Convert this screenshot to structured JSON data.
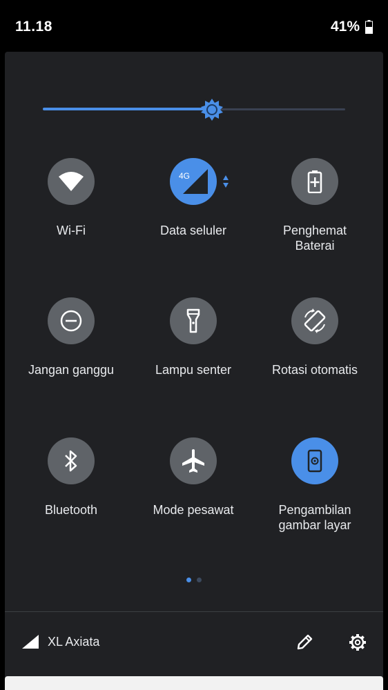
{
  "status_bar": {
    "time": "11.18",
    "battery_text": "41%"
  },
  "brightness": {
    "level": 0.56
  },
  "tiles": [
    {
      "label": "Wi-Fi",
      "icon": "wifi-icon",
      "active": false
    },
    {
      "label": "Data seluler",
      "icon": "cellular-data-icon",
      "badge": "4G",
      "active": true
    },
    {
      "label": "Penghemat\nBaterai",
      "icon": "battery-saver-icon",
      "active": false
    },
    {
      "label": "Jangan ganggu",
      "icon": "do-not-disturb-icon",
      "active": false
    },
    {
      "label": "Lampu senter",
      "icon": "flashlight-icon",
      "active": false
    },
    {
      "label": "Rotasi otomatis",
      "icon": "auto-rotate-icon",
      "active": false
    },
    {
      "label": "Bluetooth",
      "icon": "bluetooth-icon",
      "active": false
    },
    {
      "label": "Mode pesawat",
      "icon": "airplane-icon",
      "active": false
    },
    {
      "label": "Pengambilan\ngambar layar",
      "icon": "screenshot-icon",
      "active": true
    }
  ],
  "page_indicator": {
    "current": 1,
    "total": 2
  },
  "footer": {
    "carrier": "XL Axiata",
    "carrier_icon": "signal-icon",
    "edit_icon": "pencil-icon",
    "settings_icon": "gear-icon"
  },
  "colors": {
    "accent": "#4a8fe8",
    "tile_inactive": "#5f6368",
    "panel": "#202124"
  }
}
